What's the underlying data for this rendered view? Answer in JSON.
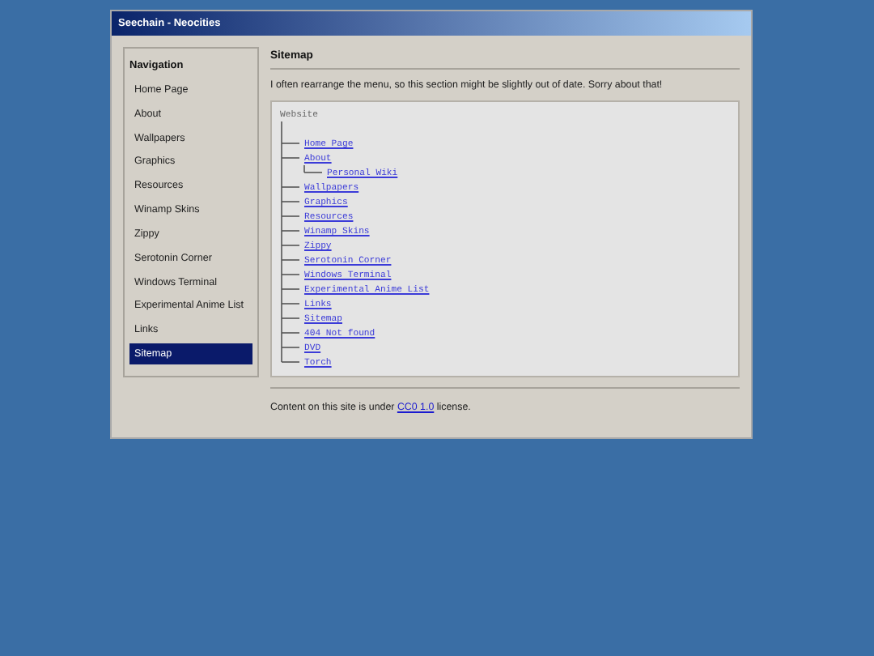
{
  "window": {
    "title": "Seechain - Neocities"
  },
  "sidebar": {
    "heading": "Navigation",
    "items": [
      {
        "label": "Home Page",
        "selected": false
      },
      {
        "label": "About",
        "selected": false
      },
      {
        "label": "Wallpapers",
        "selected": false
      },
      {
        "label": "Graphics",
        "selected": false
      },
      {
        "label": "Resources",
        "selected": false
      },
      {
        "label": "Winamp Skins",
        "selected": false
      },
      {
        "label": "Zippy",
        "selected": false
      },
      {
        "label": "Serotonin Corner",
        "selected": false
      },
      {
        "label": "Windows Terminal",
        "selected": false
      },
      {
        "label": "Experimental Anime List",
        "selected": false
      },
      {
        "label": "Links",
        "selected": false
      },
      {
        "label": "Sitemap",
        "selected": true
      }
    ]
  },
  "main": {
    "heading": "Sitemap",
    "intro": "I often rearrange the menu, so this section might be slightly out of date. Sorry about that!",
    "tree": {
      "root": "Website",
      "items": [
        {
          "label": "Home Page"
        },
        {
          "label": "About",
          "children": [
            {
              "label": "Personal Wiki"
            }
          ]
        },
        {
          "label": "Wallpapers"
        },
        {
          "label": "Graphics"
        },
        {
          "label": "Resources"
        },
        {
          "label": "Winamp Skins"
        },
        {
          "label": "Zippy"
        },
        {
          "label": "Serotonin Corner"
        },
        {
          "label": "Windows Terminal"
        },
        {
          "label": "Experimental Anime List"
        },
        {
          "label": "Links"
        },
        {
          "label": "Sitemap"
        },
        {
          "label": "404 Not found"
        },
        {
          "label": "DVD"
        },
        {
          "label": "Torch"
        }
      ]
    },
    "footer": {
      "before": "Content on this site is under",
      "link": "CC0 1.0",
      "after": "license."
    }
  }
}
